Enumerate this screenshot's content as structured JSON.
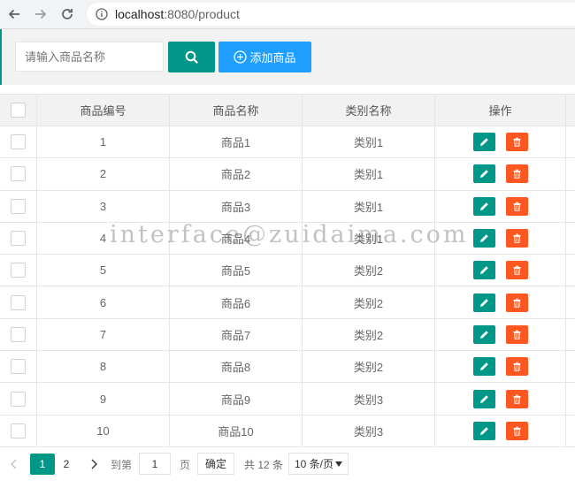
{
  "browser": {
    "url_host": "localhost",
    "url_rest": ":8080/product"
  },
  "toolbar": {
    "search_placeholder": "请输入商品名称",
    "add_label": "添加商品"
  },
  "table": {
    "headers": [
      "商品编号",
      "商品名称",
      "类别名称",
      "操作"
    ],
    "rows": [
      {
        "id": "1",
        "name": "商品1",
        "category": "类别1"
      },
      {
        "id": "2",
        "name": "商品2",
        "category": "类别1"
      },
      {
        "id": "3",
        "name": "商品3",
        "category": "类别1"
      },
      {
        "id": "4",
        "name": "商品4",
        "category": "类别1"
      },
      {
        "id": "5",
        "name": "商品5",
        "category": "类别2"
      },
      {
        "id": "6",
        "name": "商品6",
        "category": "类别2"
      },
      {
        "id": "7",
        "name": "商品7",
        "category": "类别2"
      },
      {
        "id": "8",
        "name": "商品8",
        "category": "类别2"
      },
      {
        "id": "9",
        "name": "商品9",
        "category": "类别3"
      },
      {
        "id": "10",
        "name": "商品10",
        "category": "类别3"
      }
    ]
  },
  "pager": {
    "pages": [
      "1",
      "2"
    ],
    "goto_label": "到第",
    "goto_value": "1",
    "page_unit": "页",
    "confirm_label": "确定",
    "total_label": "共 12 条",
    "page_size": "10 条/页"
  },
  "watermark": "interface@zuidaima.com",
  "colors": {
    "primary": "#009688",
    "blue": "#1e9fff",
    "danger": "#ff5722"
  }
}
